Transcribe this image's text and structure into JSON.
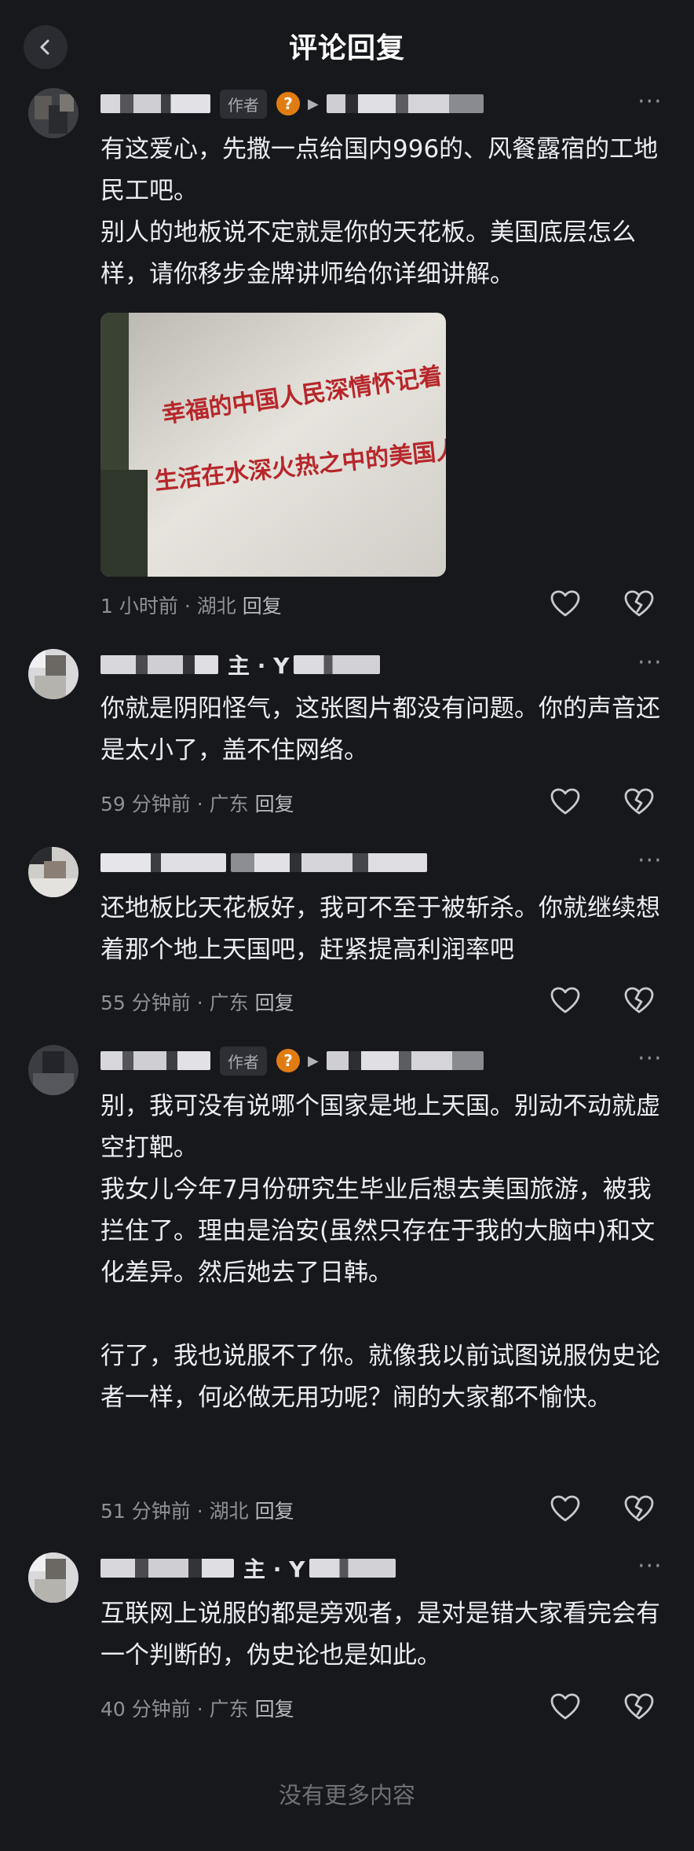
{
  "header": {
    "title": "评论回复"
  },
  "comments": [
    {
      "author_tag": "作者",
      "paragraphs": "有这爱心，先撒一点给国内996的、风餐露宿的工地民工吧。\n别人的地板说不定就是你的天花板。美国底层怎么样，请你移步金牌讲师给你详细讲解。",
      "image_text": [
        "幸福的中国人民深情怀记着",
        "生活在水深火热之中的美国人民"
      ],
      "time": "1 小时前",
      "location": "湖北",
      "reply_label": "回复"
    },
    {
      "name_fragment": "主 · Y",
      "paragraphs": "你就是阴阳怪气，这张图片都没有问题。你的声音还是太小了，盖不住网络。",
      "time": "59 分钟前",
      "location": "广东",
      "reply_label": "回复"
    },
    {
      "paragraphs": "还地板比天花板好，我可不至于被斩杀。你就继续想着那个地上天国吧，赶紧提高利润率吧",
      "time": "55 分钟前",
      "location": "广东",
      "reply_label": "回复"
    },
    {
      "author_tag": "作者",
      "paragraphs": "别，我可没有说哪个国家是地上天国。别动不动就虚空打靶。\n我女儿今年7月份研究生毕业后想去美国旅游，被我拦住了。理由是治安(虽然只存在于我的大脑中)和文化差异。然后她去了日韩。\n\n行了，我也说服不了你。就像我以前试图说服伪史论者一样，何必做无用功呢？闹的大家都不愉快。",
      "time": "51 分钟前",
      "location": "湖北",
      "reply_label": "回复"
    },
    {
      "name_fragment": "主 · Y",
      "paragraphs": "互联网上说服的都是旁观者，是对是错大家看完会有一个判断的，伪史论也是如此。",
      "time": "40 分钟前",
      "location": "广东",
      "reply_label": "回复"
    }
  ],
  "meta_separator": "·",
  "more_label": "···",
  "question_badge": "?",
  "footer_text": "没有更多内容",
  "colors": {
    "background": "#17181c",
    "text": "#ecedf0",
    "meta": "#8f9096",
    "badge": "#e07c12"
  },
  "icons": [
    "back-icon",
    "heart-icon",
    "broken-heart-icon",
    "more-icon"
  ]
}
